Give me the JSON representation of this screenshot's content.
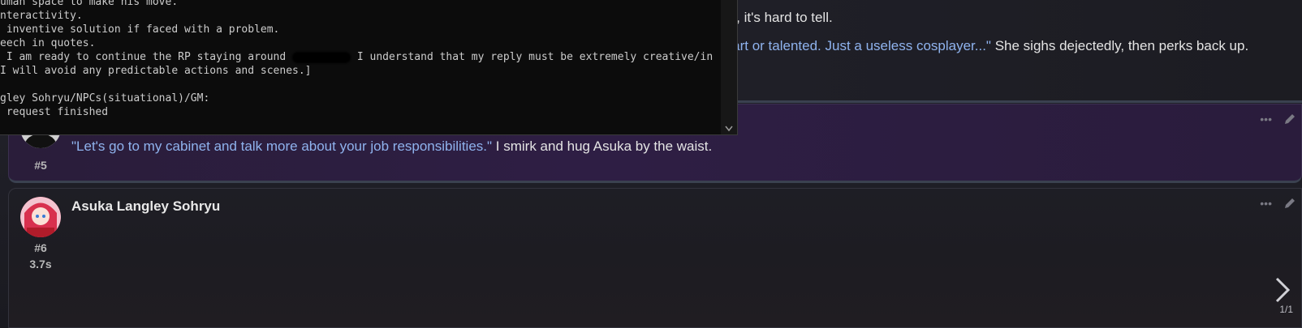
{
  "previous_message": {
    "line1": "else, it's hard to tell.",
    "line2_quote": "mart or talented. Just a useless cosplayer...\"",
    "line2_rest": " She sighs dejectedly, then perks back up."
  },
  "user_message": {
    "id": "#5",
    "quote": "\"Let's go to my cabinet and talk more about your job responsibilities.\"",
    "rest": " I smirk and hug Asuka by the waist.",
    "avatar_icon": "default-user-silhouette-icon"
  },
  "bot_message": {
    "name": "Asuka Langley Sohryu",
    "id": "#6",
    "time": "3.7s",
    "avatar_icon": "character-avatar",
    "swipe_counter": "1/1",
    "text": ""
  },
  "terminal": {
    "lines": [
      "uman space to make his move.",
      "nteractivity.",
      " inventive solution if faced with a problem.",
      "eech in quotes.",
      " I am ready to continue the RP staying around ",
      "I will avoid any predictable actions and scenes.]",
      "",
      "gley Sohryu/NPCs(situational)/GM:",
      " request finished"
    ],
    "line5_tail": " I understand that my reply must be extremely creative/in"
  },
  "colors": {
    "quote": "#8fb3ee",
    "user_bg": "#2e1e44",
    "terminal_bg": "#0c0c0c"
  }
}
